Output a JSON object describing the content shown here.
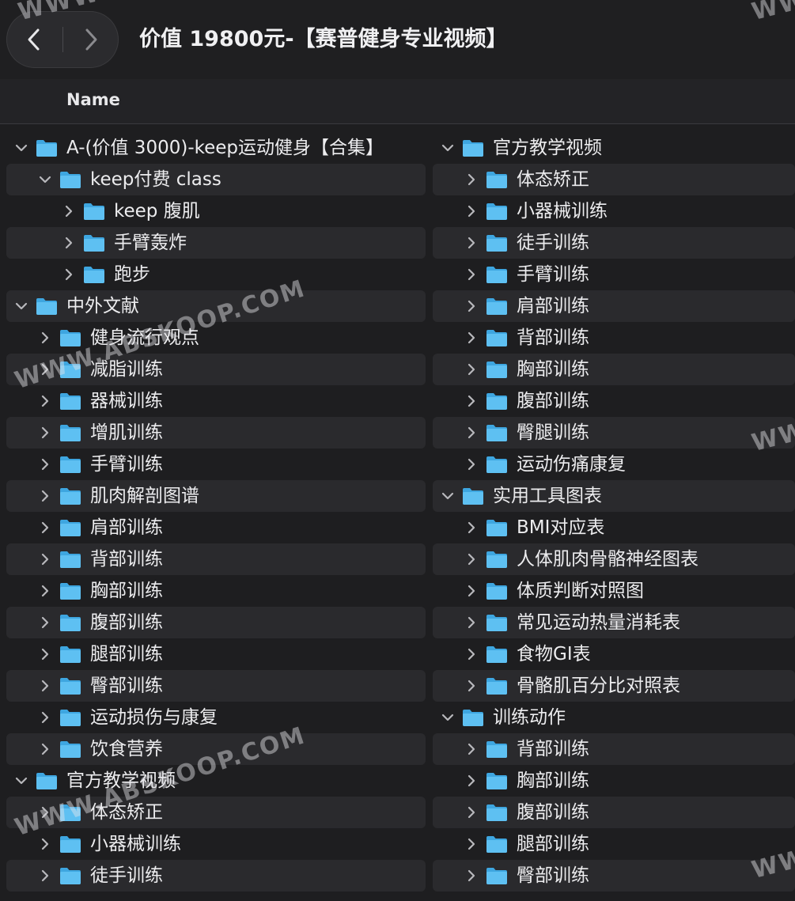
{
  "window": {
    "title": "价值 19800元-【赛普健身专业视频】",
    "back_icon": "chevron-left-icon",
    "forward_icon": "chevron-right-icon"
  },
  "header": {
    "name": "Name"
  },
  "colors": {
    "folder": "#5ec0f2",
    "folder_dark": "#3ea6e0",
    "stripe": "#2a2a2d",
    "background": "#1e1e20"
  },
  "left_items": [
    {
      "label": "A-(价值 3000)-keep运动健身【合集】",
      "depth": 0,
      "expanded": true
    },
    {
      "label": "keep付费 class",
      "depth": 1,
      "expanded": true
    },
    {
      "label": "keep 腹肌",
      "depth": 2,
      "expanded": false
    },
    {
      "label": "手臂轰炸",
      "depth": 2,
      "expanded": false
    },
    {
      "label": "跑步",
      "depth": 2,
      "expanded": false
    },
    {
      "label": "中外文献",
      "depth": 0,
      "expanded": true
    },
    {
      "label": "健身流行观点",
      "depth": 1,
      "expanded": false
    },
    {
      "label": "减脂训练",
      "depth": 1,
      "expanded": false
    },
    {
      "label": "器械训练",
      "depth": 1,
      "expanded": false
    },
    {
      "label": "增肌训练",
      "depth": 1,
      "expanded": false
    },
    {
      "label": "手臂训练",
      "depth": 1,
      "expanded": false
    },
    {
      "label": "肌肉解剖图谱",
      "depth": 1,
      "expanded": false
    },
    {
      "label": "肩部训练",
      "depth": 1,
      "expanded": false
    },
    {
      "label": "背部训练",
      "depth": 1,
      "expanded": false
    },
    {
      "label": "胸部训练",
      "depth": 1,
      "expanded": false
    },
    {
      "label": "腹部训练",
      "depth": 1,
      "expanded": false
    },
    {
      "label": "腿部训练",
      "depth": 1,
      "expanded": false
    },
    {
      "label": "臀部训练",
      "depth": 1,
      "expanded": false
    },
    {
      "label": "运动损伤与康复",
      "depth": 1,
      "expanded": false
    },
    {
      "label": "饮食营养",
      "depth": 1,
      "expanded": false
    },
    {
      "label": "官方教学视频",
      "depth": 0,
      "expanded": true
    },
    {
      "label": "体态矫正",
      "depth": 1,
      "expanded": false
    },
    {
      "label": "小器械训练",
      "depth": 1,
      "expanded": false
    },
    {
      "label": "徒手训练",
      "depth": 1,
      "expanded": false
    }
  ],
  "right_items": [
    {
      "label": "官方教学视频",
      "depth": 0,
      "expanded": true
    },
    {
      "label": "体态矫正",
      "depth": 1,
      "expanded": false
    },
    {
      "label": "小器械训练",
      "depth": 1,
      "expanded": false
    },
    {
      "label": "徒手训练",
      "depth": 1,
      "expanded": false
    },
    {
      "label": "手臂训练",
      "depth": 1,
      "expanded": false
    },
    {
      "label": "肩部训练",
      "depth": 1,
      "expanded": false
    },
    {
      "label": "背部训练",
      "depth": 1,
      "expanded": false
    },
    {
      "label": "胸部训练",
      "depth": 1,
      "expanded": false
    },
    {
      "label": "腹部训练",
      "depth": 1,
      "expanded": false
    },
    {
      "label": "臀腿训练",
      "depth": 1,
      "expanded": false
    },
    {
      "label": "运动伤痛康复",
      "depth": 1,
      "expanded": false
    },
    {
      "label": "实用工具图表",
      "depth": 0,
      "expanded": true
    },
    {
      "label": "BMI对应表",
      "depth": 1,
      "expanded": false
    },
    {
      "label": "人体肌肉骨骼神经图表",
      "depth": 1,
      "expanded": false
    },
    {
      "label": "体质判断对照图",
      "depth": 1,
      "expanded": false
    },
    {
      "label": "常见运动热量消耗表",
      "depth": 1,
      "expanded": false
    },
    {
      "label": "食物GI表",
      "depth": 1,
      "expanded": false
    },
    {
      "label": "骨骼肌百分比对照表",
      "depth": 1,
      "expanded": false
    },
    {
      "label": "训练动作",
      "depth": 0,
      "expanded": true
    },
    {
      "label": "背部训练",
      "depth": 1,
      "expanded": false
    },
    {
      "label": "胸部训练",
      "depth": 1,
      "expanded": false
    },
    {
      "label": "腹部训练",
      "depth": 1,
      "expanded": false
    },
    {
      "label": "腿部训练",
      "depth": 1,
      "expanded": false
    },
    {
      "label": "臀部训练",
      "depth": 1,
      "expanded": false
    }
  ],
  "watermarks": {
    "main": "WWW.ABSKOOP.COM",
    "edge_left": "WWW",
    "edge_right": "WW"
  }
}
